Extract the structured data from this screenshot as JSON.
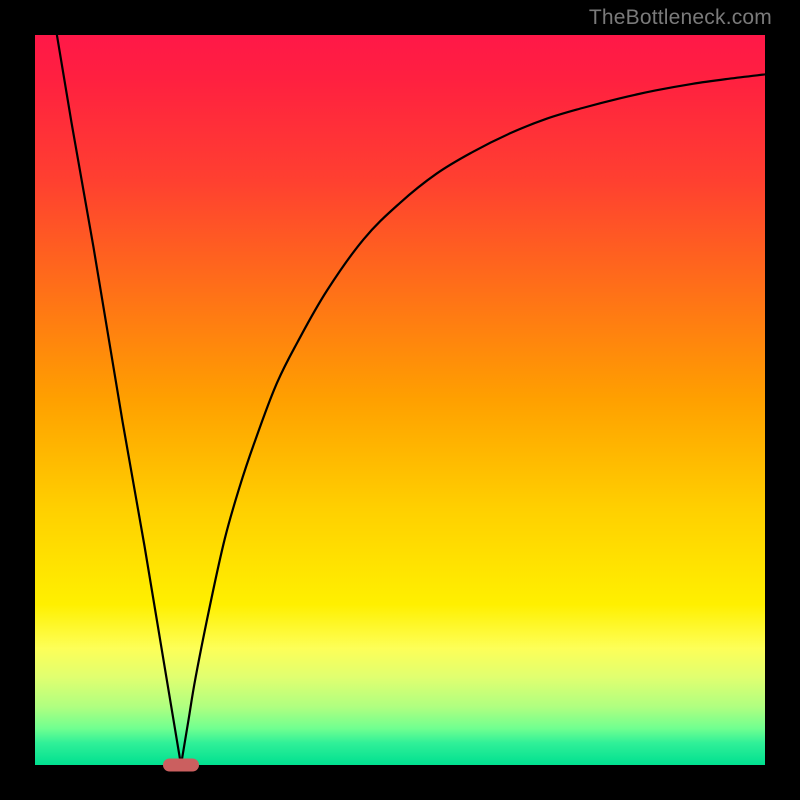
{
  "watermark": "TheBottleneck.com",
  "colors": {
    "background": "#000000",
    "curve": "#000000",
    "marker": "#cb5f5f",
    "gradient_top": "#ff1848",
    "gradient_bottom": "#00e090"
  },
  "chart_data": {
    "type": "line",
    "title": "",
    "xlabel": "",
    "ylabel": "",
    "xlim": [
      0,
      100
    ],
    "ylim": [
      0,
      100
    ],
    "legend": false,
    "grid": false,
    "annotations": [
      {
        "name": "valley-marker",
        "x": 20,
        "y": 0
      }
    ],
    "series": [
      {
        "name": "left-segment",
        "x": [
          3,
          5,
          8,
          10,
          12,
          15,
          17,
          18,
          19,
          20
        ],
        "values": [
          100,
          88,
          71,
          59,
          47,
          30,
          18,
          12,
          6,
          0
        ]
      },
      {
        "name": "right-segment",
        "x": [
          20,
          21,
          22,
          24,
          26,
          28,
          30,
          33,
          36,
          40,
          45,
          50,
          55,
          60,
          65,
          70,
          75,
          80,
          85,
          90,
          95,
          100
        ],
        "values": [
          0,
          6,
          12,
          22,
          31,
          38,
          44,
          52,
          58,
          65,
          72,
          77,
          81,
          84,
          86.5,
          88.5,
          90,
          91.3,
          92.4,
          93.3,
          94,
          94.6
        ]
      }
    ]
  }
}
